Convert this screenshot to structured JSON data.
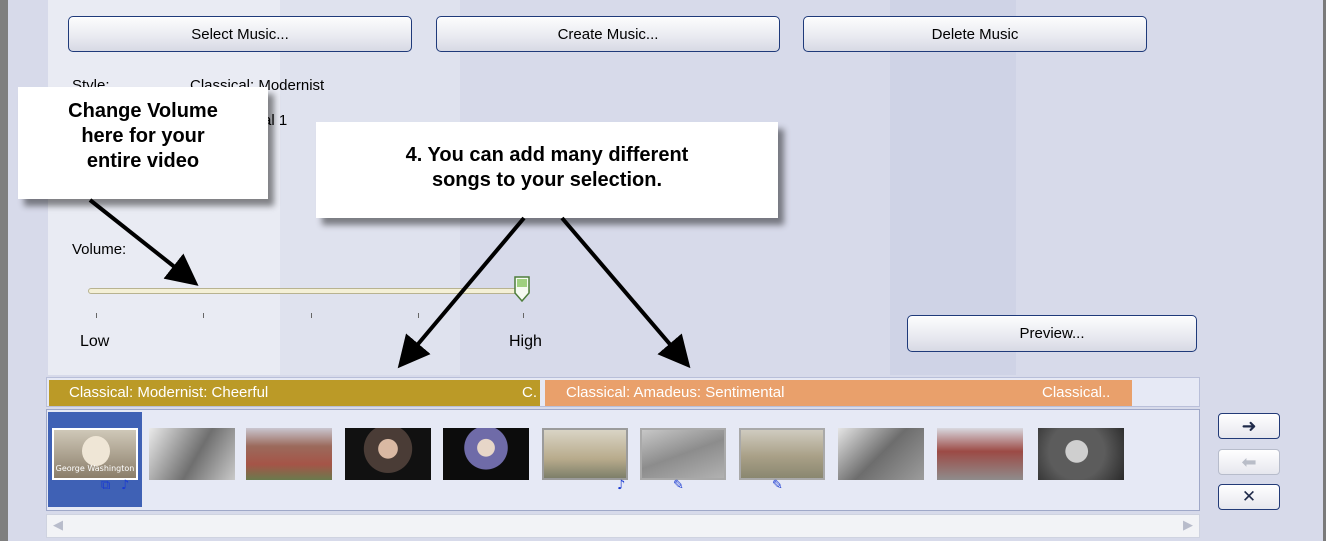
{
  "toolbar": {
    "select_label": "Select Music...",
    "create_label": "Create Music...",
    "delete_label": "Delete Music"
  },
  "info": {
    "style_label": "Style:",
    "style_value": "Classical: Modernist",
    "partial_value": "al 1"
  },
  "callouts": {
    "volume_note": [
      "Change Volume",
      "here for your",
      "entire video"
    ],
    "songs_note": [
      "4.  You can add many different",
      "songs to your selection."
    ]
  },
  "volume": {
    "label": "Volume:",
    "low_label": "Low",
    "high_label": "High",
    "level": 1.0
  },
  "preview_label": "Preview...",
  "music_track": {
    "segments": [
      {
        "title": "Classical: Modernist: Cheerful",
        "tail": "C.",
        "color": "#bb9a27"
      },
      {
        "title": "Classical: Amadeus: Sentimental",
        "tail": "Classical..",
        "color": "#e9a06b"
      }
    ]
  },
  "storyboard": {
    "first_caption": "George Washington",
    "thumbnails": [
      {
        "name": "portrait-george-washington",
        "selected": true
      },
      {
        "name": "horsemen-sketch"
      },
      {
        "name": "red-brick-house"
      },
      {
        "name": "portrait-man-dark"
      },
      {
        "name": "portrait-woman-dark"
      },
      {
        "name": "mansion-sepia"
      },
      {
        "name": "faded-scene"
      },
      {
        "name": "house-sepia"
      },
      {
        "name": "battle-horses"
      },
      {
        "name": "crowd-scene"
      },
      {
        "name": "washington-bust"
      }
    ]
  },
  "colors": {
    "accent_blue": "#1a3bd1",
    "selected_bg": "#3f61b5"
  }
}
